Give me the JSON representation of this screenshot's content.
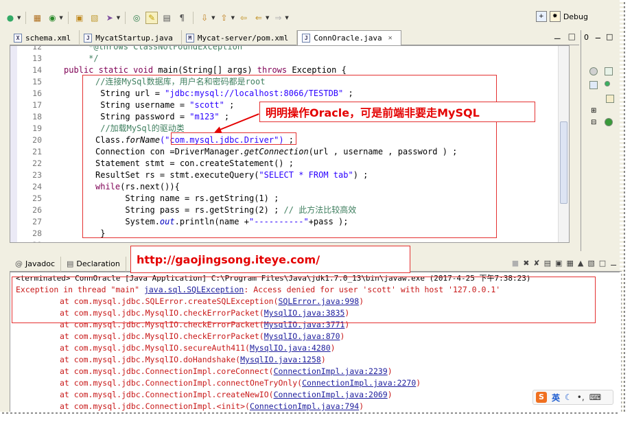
{
  "toolbar": {
    "perspective_label": "Debug"
  },
  "editor_tabs": [
    {
      "label": "schema.xml",
      "icon": "xml-file-icon",
      "active": false
    },
    {
      "label": "MycatStartup.java",
      "icon": "java-file-icon",
      "active": false
    },
    {
      "label": "Mycat-server/pom.xml",
      "icon": "maven-pom-icon",
      "active": false
    },
    {
      "label": "ConnOracle.java",
      "icon": "java-file-icon",
      "active": true
    }
  ],
  "editor": {
    "line_numbers": [
      "12",
      "13",
      "14",
      "15",
      "16",
      "17",
      "18",
      "19",
      "20",
      "21",
      "22",
      "23",
      "24",
      "25",
      "26",
      "27",
      "28",
      "29"
    ],
    "code": {
      "l12": "     *@throws ClassNotFoundException",
      "l13": "     */",
      "l14_kw1": "public static void ",
      "l14_rest": "main(String[] args) ",
      "l14_kw2": "throws ",
      "l14_end": "Exception {",
      "l15": "//连接MySql数据库，用户名和密码都是root",
      "l16_pre": " String url = ",
      "l16_str": "\"jdbc:mysql://localhost:8066/TESTDB\"",
      "l16_post": " ;",
      "l17_pre": " String username = ",
      "l17_str": "\"scott\"",
      "l17_post": " ;",
      "l18_pre": " String password = ",
      "l18_str": "\"m123\"",
      "l18_post": " ;",
      "l19": " //加载MySql的驱动类",
      "l20_pre": "Class.",
      "l20_method": "forName",
      "l20_str": "(\"com.mysql.jdbc.Driver\")",
      "l20_post": " ;",
      "l21_pre": "Connection con =DriverManager.",
      "l21_method": "getConnection",
      "l21_post": "(url , username , password ) ;",
      "l22": "Statement stmt = con.createStatement() ;",
      "l23_pre": "ResultSet rs = stmt.executeQuery(",
      "l23_str": "\"SELECT * FROM tab\"",
      "l23_post": ") ;",
      "l24_kw": "while",
      "l24_post": "(rs.next()){",
      "l25": "      String name = rs.getString(1) ;",
      "l26_pre": "      String pass = rs.getString(2) ; ",
      "l26_cm": "// 此方法比较高效",
      "l27_pre": "      System.",
      "l27_field": "out",
      "l27_mid": ".println(name +",
      "l27_str": "\"----------\"",
      "l27_post": "+pass );",
      "l28": " }",
      "l29": "."
    }
  },
  "annotations": {
    "callout_text": "明明操作Oracle，可是前端非要走MySQL",
    "url_text": "http://gaojingsong.iteye.com/"
  },
  "bottom_tabs": [
    {
      "label": "Javadoc",
      "icon": "at-icon"
    },
    {
      "label": "Declaration",
      "icon": "declaration-icon"
    }
  ],
  "console": {
    "terminated": "<terminated> ConnOracle [Java Application] C:\\Program Files\\Java\\jdk1.7.0_13\\bin\\javaw.exe (2017-4-25 下午7:38:23)",
    "exception_pre": "Exception in thread \"main\" ",
    "exception_link": "java.sql.SQLException",
    "exception_post": ": Access denied for user 'scott' with host '127.0.0.1'",
    "frames": [
      {
        "at": "at com.mysql.jdbc.SQLError.createSQLException(",
        "link": "SQLError.java:998",
        "end": ")"
      },
      {
        "at": "at com.mysql.jdbc.MysqlIO.checkErrorPacket(",
        "link": "MysqlIO.java:3835",
        "end": ")"
      },
      {
        "at": "at com.mysql.jdbc.MysqlIO.checkErrorPacket(",
        "link": "MysqlIO.java:3771",
        "end": ")"
      },
      {
        "at": "at com.mysql.jdbc.MysqlIO.checkErrorPacket(",
        "link": "MysqlIO.java:870",
        "end": ")"
      },
      {
        "at": "at com.mysql.jdbc.MysqlIO.secureAuth411(",
        "link": "MysqlIO.java:4280",
        "end": ")"
      },
      {
        "at": "at com.mysql.jdbc.MysqlIO.doHandshake(",
        "link": "MysqlIO.java:1258",
        "end": ")"
      },
      {
        "at": "at com.mysql.jdbc.ConnectionImpl.coreConnect(",
        "link": "ConnectionImpl.java:2239",
        "end": ")"
      },
      {
        "at": "at com.mysql.jdbc.ConnectionImpl.connectOneTryOnly(",
        "link": "ConnectionImpl.java:2270",
        "end": ")"
      },
      {
        "at": "at com.mysql.jdbc.ConnectionImpl.createNewIO(",
        "link": "ConnectionImpl.java:2069",
        "end": ")"
      },
      {
        "at": "at com.mysql.jdbc.ConnectionImpl.<init>(",
        "link": "ConnectionImpl.java:794",
        "end": ")"
      }
    ]
  },
  "side_panel": {
    "tab_label": "0"
  },
  "ime": {
    "logo": "S",
    "mode": "英"
  },
  "colors": {
    "annotation_red": "#e40000",
    "keyword": "#7f0055",
    "string": "#2a00ff",
    "comment": "#3f7f5f",
    "console_error": "#c81818"
  }
}
